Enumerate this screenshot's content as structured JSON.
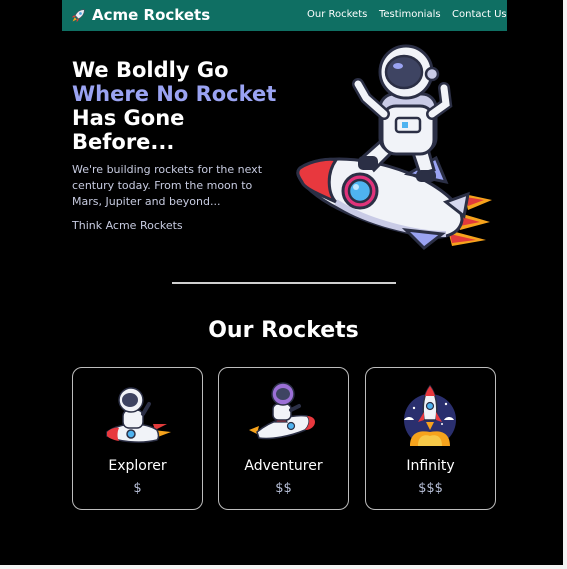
{
  "nav": {
    "brand": "Acme Rockets",
    "links": [
      "Our Rockets",
      "Testimonials",
      "Contact Us"
    ]
  },
  "hero": {
    "title_line1": "We Boldly Go",
    "title_accent": "Where No Rocket",
    "title_line3": "Has Gone",
    "title_line4": "Before...",
    "description": "We're building rockets for the next century today. From the moon to Mars, Jupiter and beyond...",
    "tagline": "Think Acme Rockets"
  },
  "rockets_section": {
    "title": "Our Rockets",
    "cards": [
      {
        "name": "Explorer",
        "price": "$"
      },
      {
        "name": "Adventurer",
        "price": "$$"
      },
      {
        "name": "Infinity",
        "price": "$$$"
      }
    ]
  },
  "colors": {
    "navbar": "#0f6f63",
    "accent": "#9aa3f2",
    "background": "#000000"
  }
}
